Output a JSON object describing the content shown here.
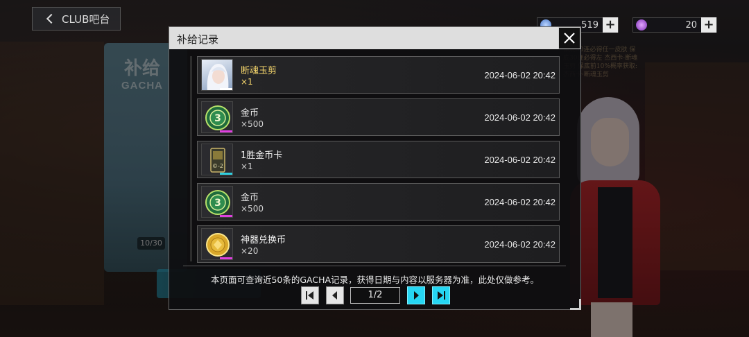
{
  "topbar": {
    "back_label": "CLUB吧台",
    "resources": [
      {
        "icon": "feather-icon",
        "value": "519",
        "color": "#7fb3ff"
      },
      {
        "icon": "gem-icon",
        "value": "20",
        "color": "#9b59d0"
      }
    ]
  },
  "background": {
    "gacha_cn": "补给",
    "gacha_en": "GACHA",
    "counter": "10/30",
    "side_text": "保底30连必得任一皮肤 保底30连必得左 杰西卡·断魂玉剪 保底前10%概率获取: 杰西卡·断魂玉剪"
  },
  "modal": {
    "title": "补给记录",
    "records": [
      {
        "name": "断魂玉剪",
        "qty": "×1",
        "date": "2024-06-02  20:42",
        "icon": "character-portrait-icon",
        "highlight": true,
        "rarity_color": "#ffffff"
      },
      {
        "name": "金币",
        "qty": "×500",
        "date": "2024-06-02  20:42",
        "icon": "gold-coin-icon",
        "highlight": false,
        "rarity_color": "#e040e0"
      },
      {
        "name": "1胜金币卡",
        "qty": "×1",
        "date": "2024-06-02  20:42",
        "icon": "coin-card-icon",
        "highlight": false,
        "rarity_color": "#2fd0e0"
      },
      {
        "name": "金币",
        "qty": "×500",
        "date": "2024-06-02  20:42",
        "icon": "gold-coin-icon",
        "highlight": false,
        "rarity_color": "#e040e0"
      },
      {
        "name": "神器兑换币",
        "qty": "×20",
        "date": "2024-06-02  20:42",
        "icon": "artifact-token-icon",
        "highlight": false,
        "rarity_color": "#e040e0"
      }
    ],
    "notice": "本页面可查询近50条的GACHA记录，获得日期与内容以服务器为准，此处仅做参考。",
    "pager": {
      "indicator": "1/2"
    }
  }
}
